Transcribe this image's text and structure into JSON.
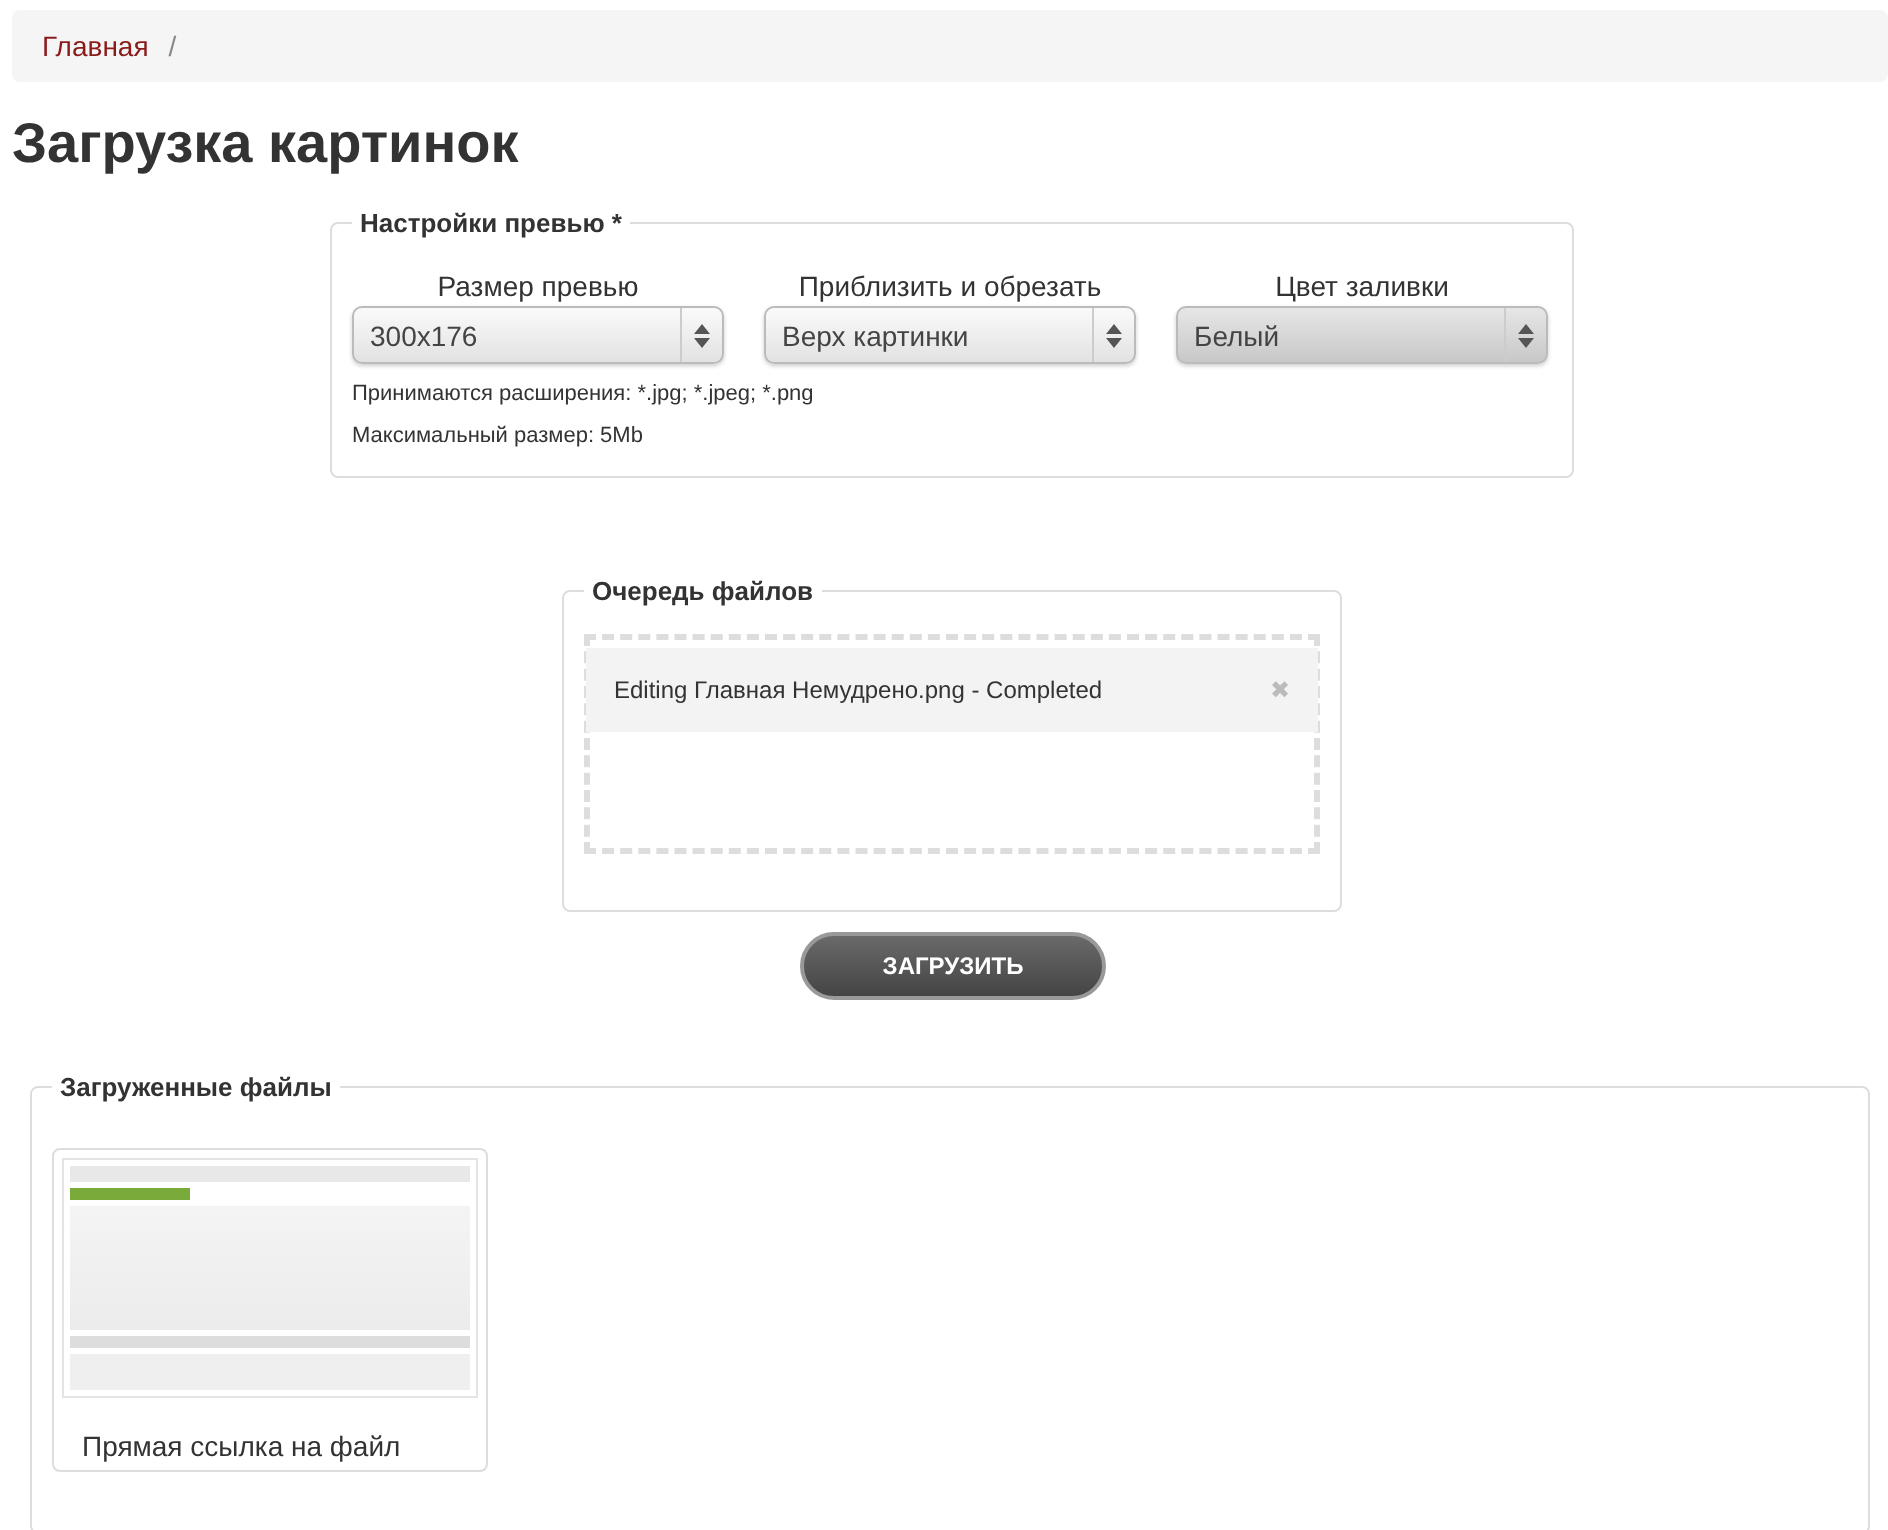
{
  "breadcrumb": [
    {
      "label": "Главная",
      "separator": "/"
    }
  ],
  "page_title": "Загрузка картинок",
  "preview_settings": {
    "legend": "Настройки превью *",
    "selects": [
      {
        "label": "Размер превью",
        "value": "300x176",
        "disabled": false
      },
      {
        "label": "Приблизить и обрезать",
        "value": "Верх картинки",
        "disabled": false
      },
      {
        "label": "Цвет заливки",
        "value": "Белый",
        "disabled": true
      }
    ],
    "notes": [
      "Принимаются расширения: *.jpg; *.jpeg; *.png",
      "Максимальный размер: 5Mb"
    ]
  },
  "file_queue": {
    "legend": "Очередь файлов",
    "items": [
      {
        "text": "Editing Главная Немудрено.png - Completed",
        "remove": "✖"
      }
    ]
  },
  "upload_button": "ЗАГРУЗИТЬ",
  "uploaded_files": {
    "legend": "Загруженные файлы",
    "files": [
      {
        "link_text": "Прямая ссылка на файл"
      }
    ]
  }
}
